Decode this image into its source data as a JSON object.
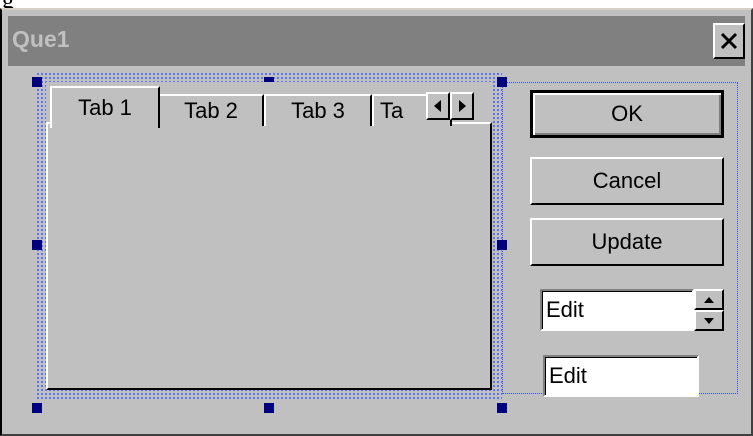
{
  "window": {
    "title": "Que1"
  },
  "scrap_text": "g",
  "tabs": [
    {
      "label": "Tab 1"
    },
    {
      "label": "Tab 2"
    },
    {
      "label": "Tab 3"
    },
    {
      "label": "Ta"
    }
  ],
  "buttons": {
    "ok": "OK",
    "cancel": "Cancel",
    "update": "Update"
  },
  "edit_spin": {
    "value": "Edit"
  },
  "edit_box": {
    "value": "Edit"
  },
  "icons": {
    "close": "close-icon",
    "tab_scroll_left": "triangle-left-icon",
    "tab_scroll_right": "triangle-right-icon",
    "spin_up": "triangle-up-icon",
    "spin_down": "triangle-down-icon"
  },
  "colors": {
    "face": "#c0c0c0",
    "titlebar_inactive": "#808080",
    "selection_handle": "#00007f",
    "selection_dots": "#4060ff"
  }
}
